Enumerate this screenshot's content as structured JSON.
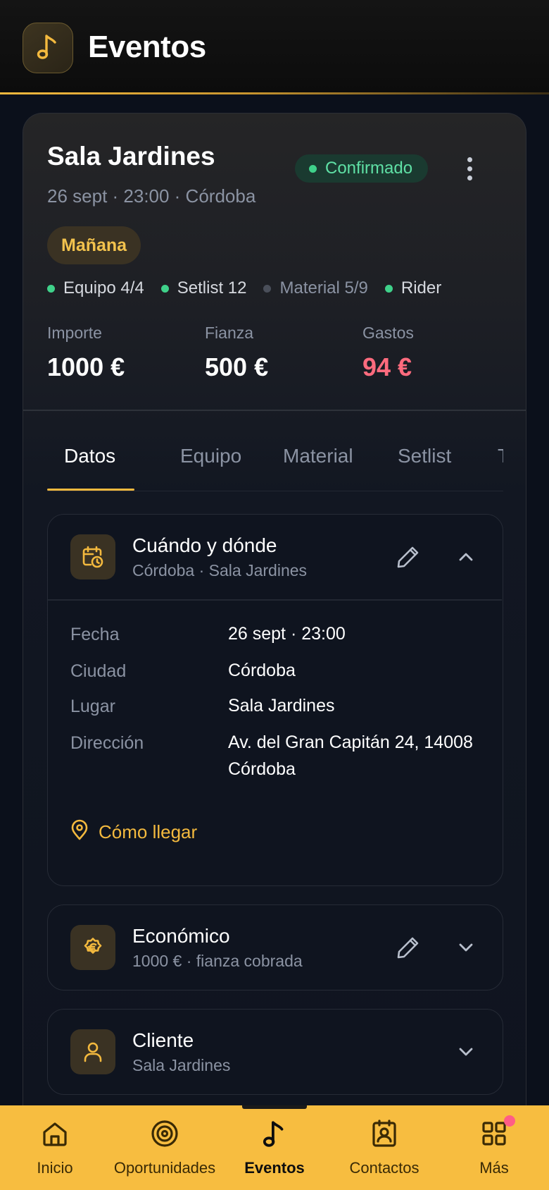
{
  "header": {
    "title": "Eventos",
    "logo_icon": "music-note-icon"
  },
  "event": {
    "title": "Sala Jardines",
    "subtitle": "26 sept · 23:00 · Córdoba",
    "status": "Confirmado",
    "when_badge": "Mañana",
    "checks": [
      {
        "label": "Equipo 4/4",
        "done": true
      },
      {
        "label": "Setlist 12",
        "done": true
      },
      {
        "label": "Material 5/9",
        "done": false
      },
      {
        "label": "Rider",
        "done": true
      }
    ],
    "money": [
      {
        "label": "Importe",
        "value": "1000 €"
      },
      {
        "label": "Fianza",
        "value": "500 €"
      },
      {
        "label": "Gastos",
        "value": "94 €"
      }
    ]
  },
  "tabs": [
    "Datos",
    "Equipo",
    "Material",
    "Setlist",
    "Téc"
  ],
  "sections": {
    "when_where": {
      "title": "Cuándo y dónde",
      "subtitle": "Córdoba · Sala Jardines",
      "rows": [
        {
          "label": "Fecha",
          "value": "26 sept · 23:00"
        },
        {
          "label": "Ciudad",
          "value": "Córdoba"
        },
        {
          "label": "Lugar",
          "value": "Sala Jardines"
        },
        {
          "label": "Dirección",
          "value": "Av. del Gran Capitán 24, 14008 Córdoba"
        }
      ],
      "directions": "Cómo llegar"
    },
    "economic": {
      "title": "Económico",
      "subtitle": "1000 € · fianza cobrada"
    },
    "client": {
      "title": "Cliente",
      "subtitle": "Sala Jardines"
    }
  },
  "nav": [
    {
      "label": "Inicio",
      "icon": "home-icon"
    },
    {
      "label": "Oportunidades",
      "icon": "target-icon"
    },
    {
      "label": "Eventos",
      "icon": "music-note-icon"
    },
    {
      "label": "Contactos",
      "icon": "contacts-icon"
    },
    {
      "label": "Más",
      "icon": "grid-icon"
    }
  ],
  "colors": {
    "accent": "#f3b93e",
    "status_green": "#3fd18a",
    "negative": "#ff6b7e",
    "nav_bg": "#f7bd40"
  }
}
